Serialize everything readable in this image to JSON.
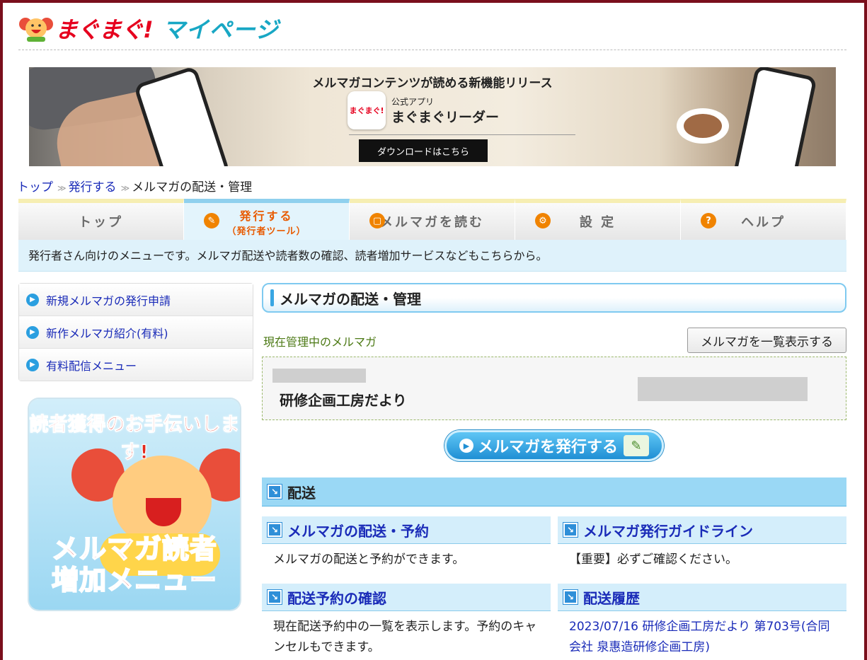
{
  "header": {
    "brand": "まぐまぐ!",
    "mypage": "マイページ"
  },
  "banner": {
    "title": "メルマガコンテンツが読める新機能リリース",
    "app_icon_text": "まぐまぐ!",
    "app_sub": "公式アプリ",
    "app_name": "まぐまぐリーダー",
    "download_label": "ダウンロードはこちら"
  },
  "breadcrumb": {
    "items": [
      "トップ",
      "発行する",
      "メルマガの配送・管理"
    ],
    "separator": "≫"
  },
  "tabs": [
    {
      "label": "トップ",
      "active": false
    },
    {
      "label": "発行する",
      "sub": "（発行者ツール）",
      "active": true
    },
    {
      "label": "メルマガを読む",
      "active": false
    },
    {
      "label": "設 定",
      "active": false
    },
    {
      "label": "ヘルプ",
      "active": false
    }
  ],
  "tab_description": "発行者さん向けのメニューです。メルマガ配送や読者数の確認、読者増加サービスなどもこちらから。",
  "left_menu": {
    "items": [
      "新規メルマガの発行申請",
      "新作メルマガ紹介(有料)",
      "有料配信メニュー"
    ]
  },
  "promo": {
    "arc_text": "読者獲得のお手伝いします!",
    "line1": "メルマガ読者",
    "line2": "増加メニュー"
  },
  "main": {
    "title": "メルマガの配送・管理",
    "managed_label": "現在管理中のメルマガ",
    "list_all_button": "メルマガを一覧表示する",
    "magazine_name": "研修企画工房だより",
    "issue_button": "メルマガを発行する",
    "section_title": "配送",
    "cards": [
      {
        "title": "メルマガの配送・予約",
        "desc": "メルマガの配送と予約ができます。"
      },
      {
        "title": "メルマガ発行ガイドライン",
        "desc": "【重要】必ずご確認ください。"
      },
      {
        "title": "配送予約の確認",
        "desc": "現在配送予約中の一覧を表示します。予約のキャンセルもできます。"
      },
      {
        "title": "配送履歴",
        "desc": "2023/07/16 研修企画工房だより 第703号(合同会社 泉惠造研修企画工房)"
      }
    ]
  },
  "colors": {
    "frame": "#7a0f1c",
    "link": "#1a2bb8",
    "accent_blue": "#2f8fd8",
    "brand_red": "#e6001e"
  }
}
